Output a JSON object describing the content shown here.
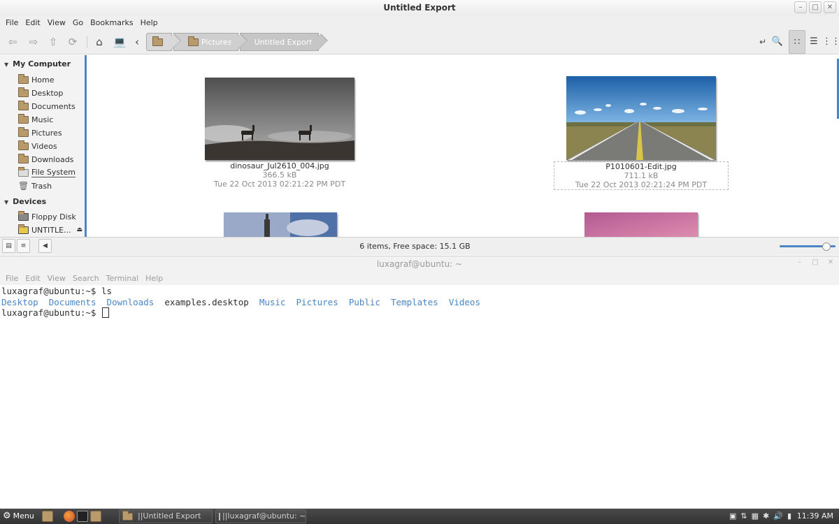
{
  "file_manager": {
    "title": "Untitled Export",
    "menu": [
      "File",
      "Edit",
      "View",
      "Go",
      "Bookmarks",
      "Help"
    ],
    "breadcrumb": [
      "Pictures",
      "Untitled Export"
    ],
    "sidebar": {
      "computer_header": "My Computer",
      "computer_items": [
        "Home",
        "Desktop",
        "Documents",
        "Music",
        "Pictures",
        "Videos",
        "Downloads",
        "File System",
        "Trash"
      ],
      "devices_header": "Devices",
      "device_items": [
        "Floppy Disk",
        "UNTITLE..."
      ]
    },
    "files": [
      {
        "name": "dinosaur_Jul2610_004.jpg",
        "size": "366.5 kB",
        "date": "Tue 22 Oct 2013 02:21:22 PM PDT"
      },
      {
        "name": "P1010601-Edit.jpg",
        "size": "711.1 kB",
        "date": "Tue 22 Oct 2013 02:21:24 PM PDT"
      }
    ],
    "status": "6 items, Free space: 15.1 GB",
    "zoom_level": 0.9
  },
  "terminal": {
    "title": "luxagraf@ubuntu: ~",
    "menu": [
      "File",
      "Edit",
      "View",
      "Search",
      "Terminal",
      "Help"
    ],
    "prompt": "luxagraf@ubuntu:~$ ",
    "command": "ls",
    "ls_entries": [
      {
        "name": "Desktop",
        "type": "dir"
      },
      {
        "name": "Documents",
        "type": "dir"
      },
      {
        "name": "Downloads",
        "type": "dir"
      },
      {
        "name": "examples.desktop",
        "type": "file"
      },
      {
        "name": "Music",
        "type": "dir"
      },
      {
        "name": "Pictures",
        "type": "dir"
      },
      {
        "name": "Public",
        "type": "dir"
      },
      {
        "name": "Templates",
        "type": "dir"
      },
      {
        "name": "Videos",
        "type": "dir"
      }
    ]
  },
  "taskbar": {
    "menu_label": "Menu",
    "tasks": [
      "||Untitled Export",
      "||luxagraf@ubuntu: ~"
    ],
    "clock": "11:39 AM"
  },
  "colors": {
    "accent": "#4a86c5",
    "dir_text": "#4a86c5"
  }
}
